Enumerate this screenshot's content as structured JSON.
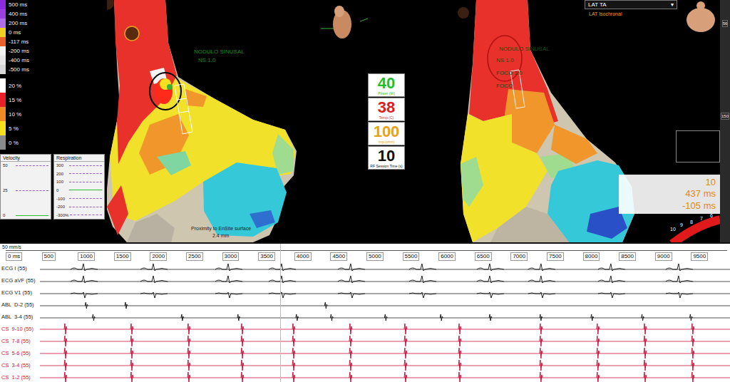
{
  "legend": {
    "lat": [
      {
        "label": "500 ms",
        "color": "#8a2be2"
      },
      {
        "label": "400 ms",
        "color": "#9b3fe0"
      },
      {
        "label": "200 ms",
        "color": "#b06ee8"
      },
      {
        "label": "0 ms",
        "color": "#f0d020"
      },
      {
        "label": "-117 ms",
        "color": "#e8602a"
      },
      {
        "label": "-200 ms",
        "color": "#f2f2f2"
      },
      {
        "label": "-400 ms",
        "color": "#e6e6e6"
      },
      {
        "label": "-500 ms",
        "color": "#d8d8d8"
      }
    ],
    "percent": [
      {
        "label": "20 %",
        "color": "#ffffff"
      },
      {
        "label": "15 %",
        "color": "#e8202a"
      },
      {
        "label": "10 %",
        "color": "#f08a24"
      },
      {
        "label": "5 %",
        "color": "#f5e020"
      },
      {
        "label": "0 %",
        "color": "#8a8a8a"
      }
    ]
  },
  "velocity": {
    "title": "Velocity",
    "ticks": [
      "50",
      "25",
      "0"
    ]
  },
  "respiration": {
    "title": "Respiration",
    "ticks": [
      "300",
      "200",
      "100",
      "0",
      "-100",
      "-200",
      "-300%"
    ]
  },
  "left_map": {
    "labels": [
      "NODULO SINUSAL",
      "NS 1.0"
    ],
    "proximity": {
      "label": "Proximity to EnSite surface",
      "value": "2.4 mm"
    }
  },
  "rf": [
    {
      "value": "40",
      "label": "Power (W)",
      "color": "#1fbf2a"
    },
    {
      "value": "38",
      "label": "Temp (C)",
      "color": "#d81e1e"
    },
    {
      "value": "100",
      "label": "Imp (ohm)",
      "color": "#e8a21a"
    },
    {
      "value": "10",
      "label": "RF Session Time (s)",
      "color": "#111111"
    }
  ],
  "right_map": {
    "labels": [
      "NODULO SINUSAL",
      "NS 1.0",
      "FOCO 1.0",
      "FOCO"
    ],
    "map_type": {
      "label": "LAT TA",
      "arrow": "▾"
    },
    "map_style": "LAT Isochronal",
    "readout": [
      "10",
      "437 ms",
      "-105 ms"
    ],
    "electrodes": [
      "10",
      "9",
      "8",
      "7",
      "6"
    ]
  },
  "toolbar": [
    "56",
    "150"
  ],
  "trace_panel": {
    "speed": "50 mm/s",
    "ruler": [
      "0 ms",
      "500",
      "1000",
      "1500",
      "2000",
      "2500",
      "3000",
      "3500",
      "4000",
      "4500",
      "5000",
      "5500",
      "6000",
      "6500",
      "7000",
      "7500",
      "8000",
      "8500",
      "9000",
      "9500"
    ],
    "cursor_ms": 3800,
    "channels": [
      {
        "name": "ECG I (55)",
        "kind": "ecg",
        "color": "#222222",
        "beats": [
          1057,
          2026,
          3063,
          3804,
          4762,
          5750,
          6689,
          7400,
          8368,
          9307
        ]
      },
      {
        "name": "ECG aVF (55)",
        "kind": "ecg",
        "color": "#222222",
        "beats": [
          1057,
          2026,
          3063,
          3804,
          4762,
          5750,
          6689,
          7400,
          8368,
          9307
        ]
      },
      {
        "name": "ECG V1 (55)",
        "kind": "ecg-inverted",
        "color": "#222222",
        "beats": [
          1057,
          2026,
          3063,
          3804,
          4762,
          5750,
          6689,
          7400,
          8368,
          9307
        ]
      },
      {
        "name": "ABL  D-2 (55)",
        "kind": "abl",
        "color": "#222222",
        "beats": [
          1100,
          1650,
          4420
        ]
      },
      {
        "name": "ABL  3-4 (55)",
        "kind": "abl",
        "color": "#222222",
        "beats": [
          1200,
          2430,
          3210,
          4020,
          4500,
          5250,
          6020,
          6700,
          7400,
          8110,
          8810,
          9480
        ]
      },
      {
        "name": "CS  9-10 (55)",
        "kind": "cs",
        "color": "#c8143c",
        "beats": [
          810,
          1729,
          2519,
          3261,
          3972,
          4762,
          5523,
          6275,
          7400,
          8190,
          8844,
          9505
        ]
      },
      {
        "name": "CS  7-8 (55)",
        "kind": "cs",
        "color": "#c8143c",
        "beats": [
          810,
          1729,
          2519,
          3261,
          3972,
          4762,
          5523,
          6275,
          7400,
          8190,
          8844,
          9505
        ]
      },
      {
        "name": "CS  5-6 (55)",
        "kind": "cs",
        "color": "#c8143c",
        "beats": [
          810,
          1729,
          2519,
          3261,
          3972,
          4762,
          5523,
          6275,
          7400,
          8190,
          8844,
          9505
        ]
      },
      {
        "name": "CS  3-4 (55)",
        "kind": "cs",
        "color": "#c8143c",
        "beats": [
          810,
          1729,
          2519,
          3261,
          3972,
          4762,
          5523,
          6275,
          7400,
          8190,
          8844,
          9505
        ]
      },
      {
        "name": "CS  1-2 (55)",
        "kind": "cs",
        "color": "#c8143c",
        "beats": [
          810,
          1729,
          2519,
          3261,
          3972,
          4762,
          5523,
          6275,
          7400,
          8190,
          8844,
          9505
        ]
      }
    ]
  }
}
